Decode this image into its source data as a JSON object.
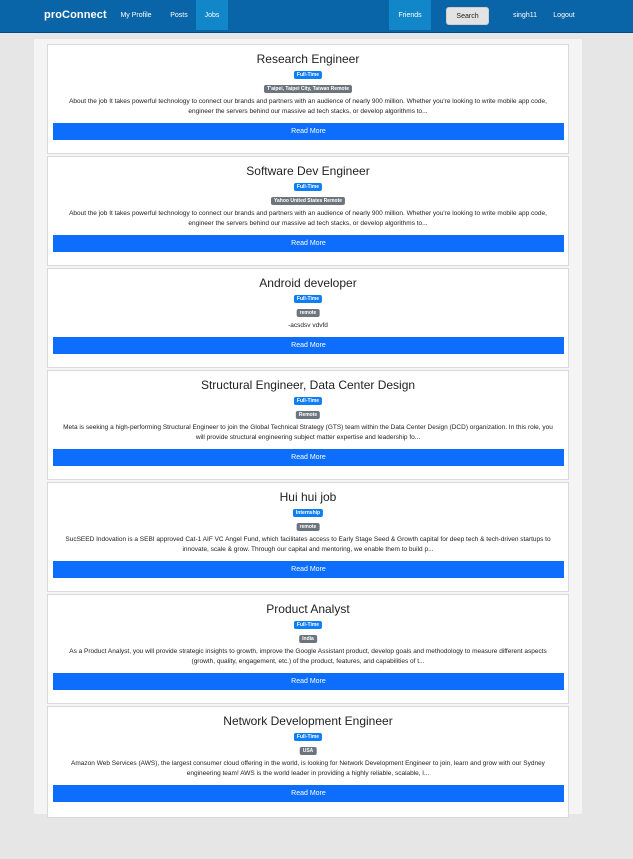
{
  "navbar": {
    "brand": "proConnect",
    "links": [
      "My Profile",
      "Posts",
      "Jobs"
    ],
    "friends": "Friends",
    "search": "Search",
    "username": "singh11",
    "logout": "Logout"
  },
  "jobs": [
    {
      "title": "Research Engineer",
      "type": "Full-Time",
      "location": "T'aipei, Taipei City, Taiwan Remote",
      "description": "About the job It takes powerful technology to connect our brands and partners with an audience of nearly 900 million. Whether you're looking to write mobile app code, engineer the servers behind our massive ad tech stacks, or develop algorithms to...",
      "action": "Read More"
    },
    {
      "title": "Software Dev Engineer",
      "type": "Full-Time",
      "location": "Yahoo United States Remote",
      "description": "About the job It takes powerful technology to connect our brands and partners with an audience of nearly 900 million. Whether you're looking to write mobile app code, engineer the servers behind our massive ad tech stacks, or develop algorithms to...",
      "action": "Read More"
    },
    {
      "title": "Android developer",
      "type": "Full-Time",
      "location": "remote",
      "description": "-acsdsv vdvfd",
      "action": "Read More"
    },
    {
      "title": "Structural Engineer, Data Center Design",
      "type": "Full-Time",
      "location": "Remote",
      "description": "Meta is seeking a high-performing Structural Engineer to join the Global Technical Strategy (GTS) team within the Data Center Design (DCD) organization. In this role, you will provide structural engineering subject matter expertise and leadership fo...",
      "action": "Read More"
    },
    {
      "title": "Hui hui job",
      "type": "Internship",
      "location": "remote",
      "description": "SucSEED Indovation is a SEBI approved Cat-1 AIF VC Angel Fund, which facilitates access to Early Stage Seed & Growth capital for deep tech & tech-driven startups to innovate, scale & grow. Through our capital and mentoring, we enable them to build p...",
      "action": "Read More"
    },
    {
      "title": "Product Analyst",
      "type": "Full-Time",
      "location": "India",
      "description": "As a Product Analyst, you will provide strategic insights to growth, improve the Google Assistant product, develop goals and methodology to measure different aspects (growth, quality, engagement, etc.) of the product, features, and capabilities of t...",
      "action": "Read More"
    },
    {
      "title": "Network Development Engineer",
      "type": "Full-Time",
      "location": "USA",
      "description": "Amazon Web Services (AWS), the largest consumer cloud offering in the world, is looking for Network Development Engineer to join, learn and grow with our Sydney engineering team! AWS is the world leader in providing a highly reliable, scalable, l...",
      "action": "Read More"
    }
  ]
}
